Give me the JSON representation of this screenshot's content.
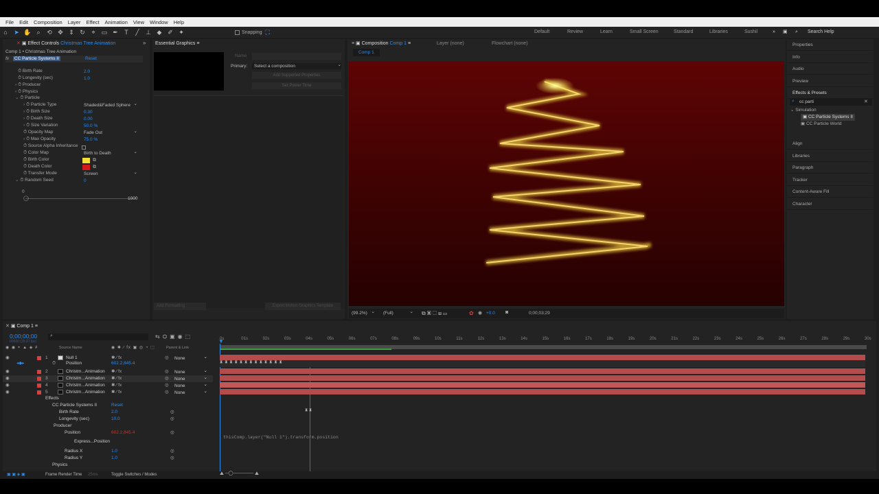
{
  "menu": [
    "File",
    "Edit",
    "Composition",
    "Layer",
    "Effect",
    "Animation",
    "View",
    "Window",
    "Help"
  ],
  "toolbar": {
    "snapping": "Snapping",
    "workspaces": [
      "Default",
      "Review",
      "Learn",
      "Small Screen",
      "Standard",
      "Libraries",
      "Sushil"
    ],
    "search": "Search Help"
  },
  "effect_controls": {
    "tab": "Effect Controls",
    "tab_layer": "Christmas Tree Animation",
    "path": "Comp 1 • Christmas Tree Animation",
    "effect": "CC Particle Systems II",
    "reset": "Reset",
    "rows": [
      {
        "label": "Birth Rate",
        "value": "2.0"
      },
      {
        "label": "Longevity (sec)",
        "value": "1.0"
      },
      {
        "label": "Producer"
      },
      {
        "label": "Physics"
      },
      {
        "label": "Particle"
      },
      {
        "label": "Particle Type",
        "value": "Shaded&Faded Sphere"
      },
      {
        "label": "Birth Size",
        "value": "0.30"
      },
      {
        "label": "Death Size",
        "value": "0.00"
      },
      {
        "label": "Size Variation",
        "value": "50.0 %"
      },
      {
        "label": "Opacity Map",
        "value": "Fade Out"
      },
      {
        "label": "Max Opacity",
        "value": "75.0 %"
      },
      {
        "label": "Source Alpha Inheritance"
      },
      {
        "label": "Color Map",
        "value": "Birth to Death"
      },
      {
        "label": "Birth Color"
      },
      {
        "label": "Death Color"
      },
      {
        "label": "Transfer Mode",
        "value": "Screen"
      },
      {
        "label": "Random Seed",
        "value": "0"
      }
    ],
    "slider_min": "0",
    "slider_max": "1000",
    "birth_color": "#f5e03a",
    "death_color": "#d11a1a"
  },
  "essential": {
    "tab": "Essential Graphics",
    "name_label": "Name",
    "primary_label": "Primary:",
    "primary_value": "Select a composition",
    "btn1": "Add Supported Properties",
    "btn2": "Set Poster Time",
    "btn3": "Add Formatting",
    "btn4": "Export Motion Graphics Template"
  },
  "comp": {
    "tab": "Composition",
    "comp_name": "Comp 1",
    "layer_tab": "Layer  (none)",
    "flow_tab": "Flowchart  (none)",
    "subtab": "Comp 1",
    "zoom": "(99.2%)",
    "quality": "(Full)",
    "plus": "+0.0",
    "time": "0;00;03;29"
  },
  "right_panels": [
    "Properties",
    "Info",
    "Audio",
    "Preview",
    "Effects & Presets",
    "Align",
    "Libraries",
    "Paragraph",
    "Tracker",
    "Content-Aware Fill",
    "Character"
  ],
  "effects_presets": {
    "search": "cc parti",
    "category": "Simulation",
    "items": [
      "CC Particle Systems II",
      "CC Particle World"
    ]
  },
  "timeline": {
    "tab": "Comp 1",
    "timecode": "0;00;00;00",
    "fps": "00000 (29.97 fps)",
    "col_source": "Source Name",
    "col_parent": "Parent & Link",
    "ruler": [
      "0s",
      "01s",
      "02s",
      "03s",
      "04s",
      "05s",
      "06s",
      "07s",
      "08s",
      "09s",
      "10s",
      "11s",
      "12s",
      "13s",
      "14s",
      "15s",
      "16s",
      "17s",
      "18s",
      "19s",
      "20s",
      "21s",
      "22s",
      "23s",
      "24s",
      "25s",
      "26s",
      "27s",
      "28s",
      "29s",
      "30s"
    ],
    "layers": [
      {
        "num": "1",
        "name": "Null 1",
        "parent": "None"
      },
      {
        "num": "",
        "name": "Position",
        "value": "602.2,845.4"
      },
      {
        "num": "2",
        "name": "Christm...Animation",
        "parent": "None"
      },
      {
        "num": "3",
        "name": "Christm...Animation",
        "parent": "None"
      },
      {
        "num": "4",
        "name": "Christm...Animation",
        "parent": "None"
      },
      {
        "num": "5",
        "name": "Christm...Animation",
        "parent": "None"
      }
    ],
    "props": [
      {
        "name": "Effects"
      },
      {
        "name": "CC Particle Systems II",
        "value": "Reset"
      },
      {
        "name": "Birth Rate",
        "value": "2.0"
      },
      {
        "name": "Longevity (sec)",
        "value": "10.0"
      },
      {
        "name": "Producer"
      },
      {
        "name": "Position",
        "value": "602.2,845.4"
      },
      {
        "name": "Express...Position"
      },
      {
        "name": "Radius X",
        "value": "1.0"
      },
      {
        "name": "Radius Y",
        "value": "1.0"
      },
      {
        "name": "Physics"
      }
    ],
    "expression": "thisComp.layer(\"Null 1\").transform.position",
    "frame_render": "Frame Render Time",
    "frame_ms": "25ms",
    "toggle": "Toggle Switches / Modes"
  },
  "colors": {
    "accent": "#2d8ceb",
    "track": "#b34c4c",
    "playhead": "#d33"
  }
}
